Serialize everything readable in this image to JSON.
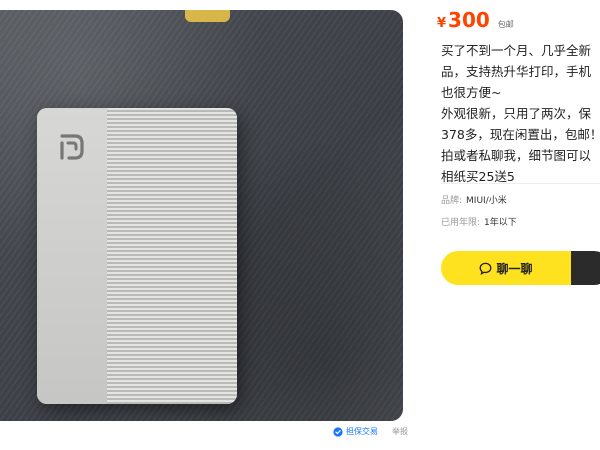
{
  "listing": {
    "currency": "¥",
    "price": "300",
    "shipping": "包邮",
    "description": "买了不到一个月、几乎全新\n品，支持热升华打印，手机\n也很方便~\n外观很新，只用了两次，保\n378多，现在闲置出，包邮！\n拍或者私聊我，细节图可以\n相纸买25送5",
    "brand_label": "品牌:",
    "brand_value": "MIUI/小米",
    "used_label": "已用年限:",
    "used_value": "1年以下",
    "chat_label": "聊一聊",
    "secure_label": "担保交易",
    "report_label": "举报"
  },
  "colors": {
    "price": "#ff4400",
    "chat_button": "#ffe21f",
    "buy_button": "#2b2b2b",
    "secure_link": "#1677ff"
  },
  "icons": {
    "chat": "chat-bubble-icon",
    "secure": "shield-check-icon",
    "device_logo": "mi-logo-icon"
  }
}
